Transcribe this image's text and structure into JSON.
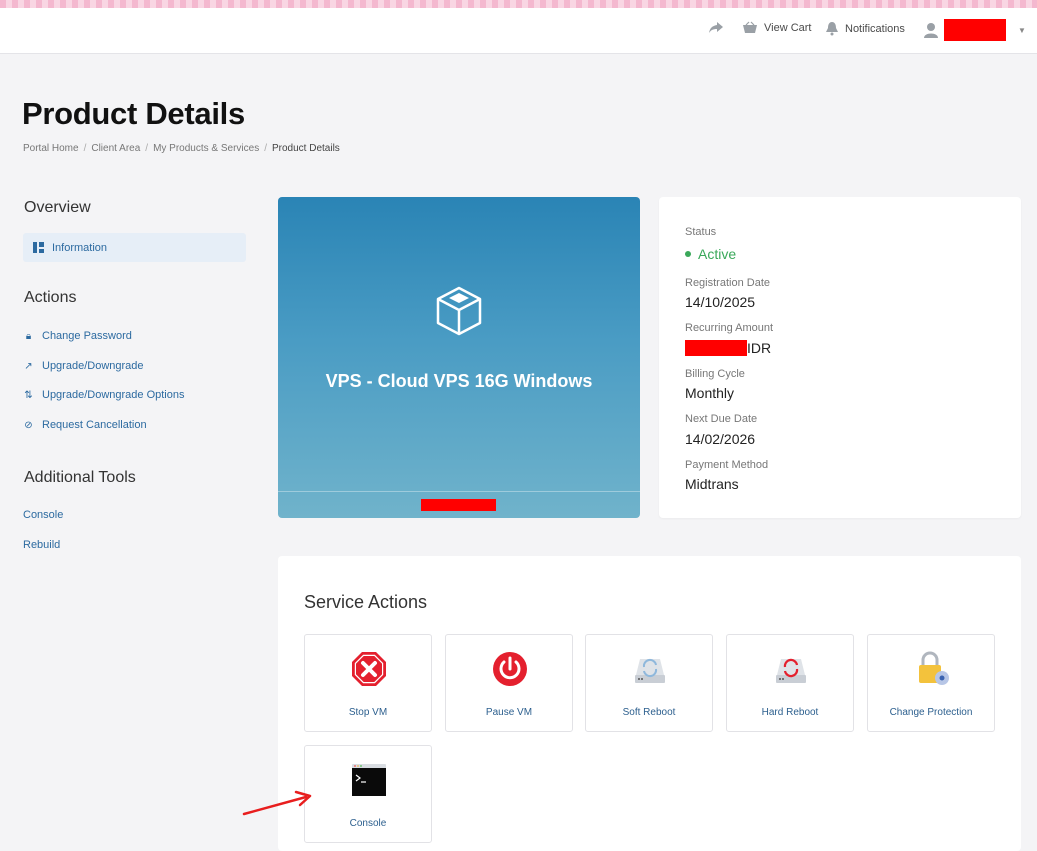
{
  "header": {
    "view_cart": "View Cart",
    "notifications": "Notifications"
  },
  "page": {
    "title": "Product Details",
    "breadcrumb": [
      "Portal Home",
      "Client Area",
      "My Products & Services",
      "Product Details"
    ]
  },
  "sidebar": {
    "overview_heading": "Overview",
    "information": "Information",
    "actions_heading": "Actions",
    "actions": [
      "Change Password",
      "Upgrade/Downgrade",
      "Upgrade/Downgrade Options",
      "Request Cancellation"
    ],
    "tools_heading": "Additional Tools",
    "tools": [
      "Console",
      "Rebuild"
    ]
  },
  "product": {
    "name": "VPS - Cloud VPS 16G Windows"
  },
  "status": {
    "status_label": "Status",
    "status_value": "Active",
    "registration_label": "Registration Date",
    "registration_value": "14/10/2025",
    "recurring_label": "Recurring Amount",
    "recurring_currency": "IDR",
    "billing_label": "Billing Cycle",
    "billing_value": "Monthly",
    "next_due_label": "Next Due Date",
    "next_due_value": "14/02/2026",
    "payment_label": "Payment Method",
    "payment_value": "Midtrans"
  },
  "service_actions": {
    "title": "Service Actions",
    "tiles": [
      "Stop VM",
      "Pause VM",
      "Soft Reboot",
      "Hard Reboot",
      "Change Protection",
      "Console"
    ]
  },
  "colors": {
    "accent": "#2c6aa0",
    "active_green": "#3aa85a",
    "redaction": "#ff0000"
  }
}
